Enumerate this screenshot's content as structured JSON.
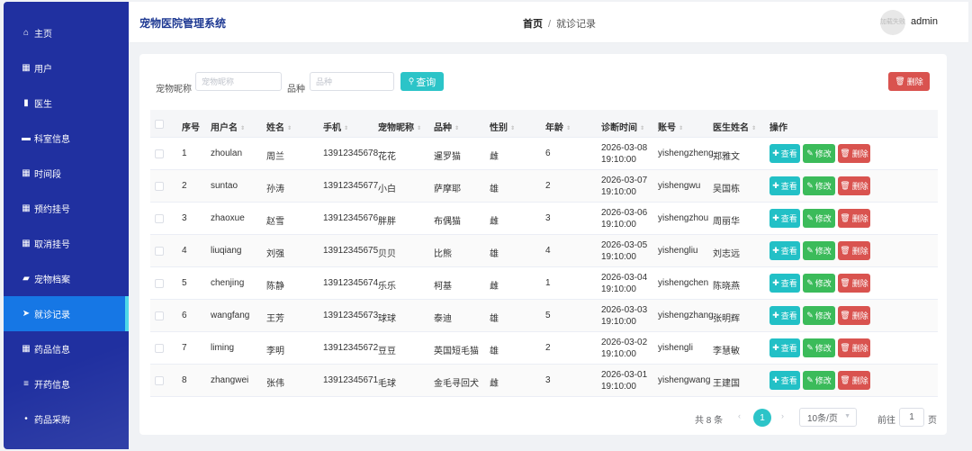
{
  "sidebar": {
    "items": [
      {
        "icon": "⌂",
        "icon_name": "home-icon",
        "label": "主页"
      },
      {
        "icon": "▦",
        "icon_name": "grid-icon",
        "label": "用户"
      },
      {
        "icon": "▮",
        "icon_name": "bar-chart-icon",
        "label": "医生"
      },
      {
        "icon": "▬",
        "icon_name": "monitor-icon",
        "label": "科室信息"
      },
      {
        "icon": "▦",
        "icon_name": "grid-icon",
        "label": "时间段"
      },
      {
        "icon": "▦",
        "icon_name": "grid-icon",
        "label": "预约挂号"
      },
      {
        "icon": "▦",
        "icon_name": "grid-icon",
        "label": "取消挂号"
      },
      {
        "icon": "▰",
        "icon_name": "briefcase-icon",
        "label": "宠物档案"
      },
      {
        "icon": "➤",
        "icon_name": "send-icon",
        "label": "就诊记录"
      },
      {
        "icon": "▦",
        "icon_name": "grid-icon",
        "label": "药品信息"
      },
      {
        "icon": "≡",
        "icon_name": "list-icon",
        "label": "开药信息"
      },
      {
        "icon": "•",
        "icon_name": "more-icon",
        "label": "药品采购"
      }
    ],
    "active_index": 8
  },
  "header": {
    "title": "宠物医院管理系统",
    "breadcrumb_home": "首页",
    "breadcrumb_sep": "/",
    "breadcrumb_current": "就诊记录",
    "avatar_text": "加载失败",
    "username": "admin"
  },
  "search": {
    "nickname_label": "宠物昵称",
    "nickname_placeholder": "宠物昵称",
    "breed_label": "品种",
    "breed_placeholder": "品种",
    "search_button": "查询",
    "delete_button": "删除"
  },
  "table": {
    "columns": [
      {
        "label": "序号",
        "sortable": false
      },
      {
        "label": "用户名",
        "sortable": true
      },
      {
        "label": "姓名",
        "sortable": true
      },
      {
        "label": "手机",
        "sortable": true
      },
      {
        "label": "宠物昵称",
        "sortable": true
      },
      {
        "label": "品种",
        "sortable": true
      },
      {
        "label": "性别",
        "sortable": true
      },
      {
        "label": "年龄",
        "sortable": true
      },
      {
        "label": "诊断时间",
        "sortable": true
      },
      {
        "label": "账号",
        "sortable": true
      },
      {
        "label": "医生姓名",
        "sortable": true
      },
      {
        "label": "操作",
        "sortable": false
      }
    ],
    "sort_glyph": "⇕",
    "rows": [
      [
        "1",
        "zhoulan",
        "周兰",
        "13912345678",
        "花花",
        "暹罗猫",
        "雌",
        "6",
        "2026-03-08 19:10:00",
        "yishengzheng",
        "郑雅文"
      ],
      [
        "2",
        "suntao",
        "孙涛",
        "13912345677",
        "小白",
        "萨摩耶",
        "雄",
        "2",
        "2026-03-07 19:10:00",
        "yishengwu",
        "吴国栋"
      ],
      [
        "3",
        "zhaoxue",
        "赵雪",
        "13912345676",
        "胖胖",
        "布偶猫",
        "雌",
        "3",
        "2026-03-06 19:10:00",
        "yishengzhou",
        "周丽华"
      ],
      [
        "4",
        "liuqiang",
        "刘强",
        "13912345675",
        "贝贝",
        "比熊",
        "雄",
        "4",
        "2026-03-05 19:10:00",
        "yishengliu",
        "刘志远"
      ],
      [
        "5",
        "chenjing",
        "陈静",
        "13912345674",
        "乐乐",
        "柯基",
        "雌",
        "1",
        "2026-03-04 19:10:00",
        "yishengchen",
        "陈晓燕"
      ],
      [
        "6",
        "wangfang",
        "王芳",
        "13912345673",
        "球球",
        "泰迪",
        "雄",
        "5",
        "2026-03-03 19:10:00",
        "yishengzhang",
        "张明辉"
      ],
      [
        "7",
        "liming",
        "李明",
        "13912345672",
        "豆豆",
        "英国短毛猫",
        "雄",
        "2",
        "2026-03-02 19:10:00",
        "yishengli",
        "李慧敏"
      ],
      [
        "8",
        "zhangwei",
        "张伟",
        "13912345671",
        "毛球",
        "金毛寻回犬",
        "雌",
        "3",
        "2026-03-01 19:10:00",
        "yishengwang",
        "王建国"
      ]
    ],
    "row_actions": {
      "view": "查看",
      "edit": "修改",
      "delete": "删除"
    }
  },
  "pagination": {
    "total_text": "共 8 条",
    "current_page": "1",
    "page_size": "10条/页",
    "goto_label": "前往",
    "goto_value": "1",
    "goto_unit": "页"
  },
  "colors": {
    "sidebar_bg": "#2030a0",
    "sidebar_active": "#1677e5",
    "primary": "#2cc4c8",
    "success": "#3bbb5a",
    "danger": "#d9534f"
  }
}
